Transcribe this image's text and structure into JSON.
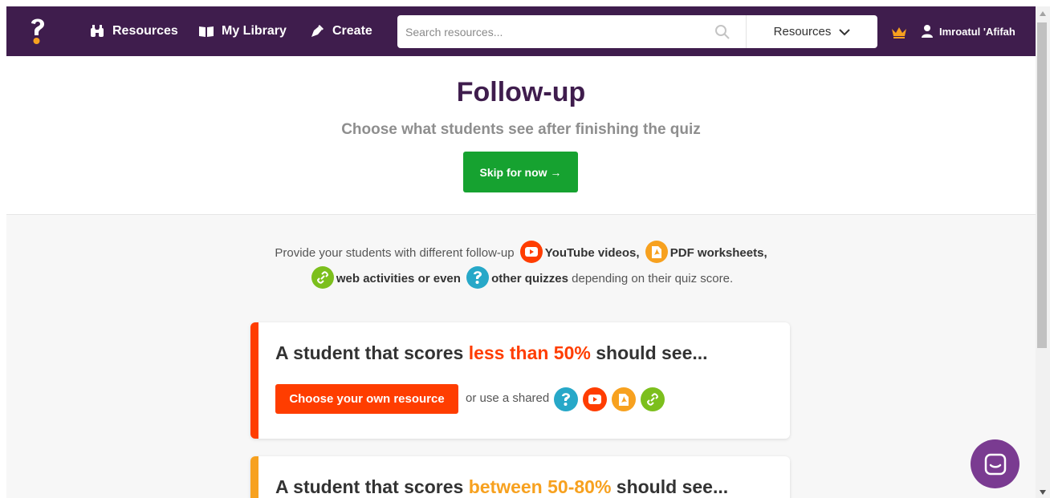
{
  "nav": {
    "resources_label": "Resources",
    "library_label": "My Library",
    "create_label": "Create",
    "search_placeholder": "Search resources...",
    "search_scope": "Resources",
    "user_name": "Imroatul 'Afifah"
  },
  "hero": {
    "title": "Follow-up",
    "subtitle": "Choose what students see after finishing the quiz",
    "skip_label": "Skip for now →"
  },
  "intro": {
    "prefix": "Provide your students with different follow-up",
    "youtube": "YouTube videos,",
    "pdf": "PDF worksheets,",
    "web": "web activities or even",
    "quizzes": "other quizzes",
    "suffix": "depending on their quiz score."
  },
  "cards": [
    {
      "prefix": "A student that scores",
      "highlight": "less than 50%",
      "suffix": "should see...",
      "choose_label": "Choose your own resource",
      "shared_label": "or use a shared"
    },
    {
      "prefix": "A student that scores",
      "highlight": "between 50-80%",
      "suffix": "should see..."
    }
  ],
  "colors": {
    "nav_bg": "#3f1d4d",
    "accent_green": "#16a230",
    "red": "#ff3d00",
    "orange": "#f7a11f",
    "lime": "#7cbf1d",
    "teal": "#27a8c8",
    "chat_purple": "#7a3b91"
  },
  "icons": [
    "binoculars-icon",
    "book-icon",
    "pen-icon",
    "search-icon",
    "chevron-down-icon",
    "crown-icon",
    "user-icon",
    "youtube-icon",
    "pdf-icon",
    "link-icon",
    "quiz-icon",
    "chat-icon"
  ]
}
